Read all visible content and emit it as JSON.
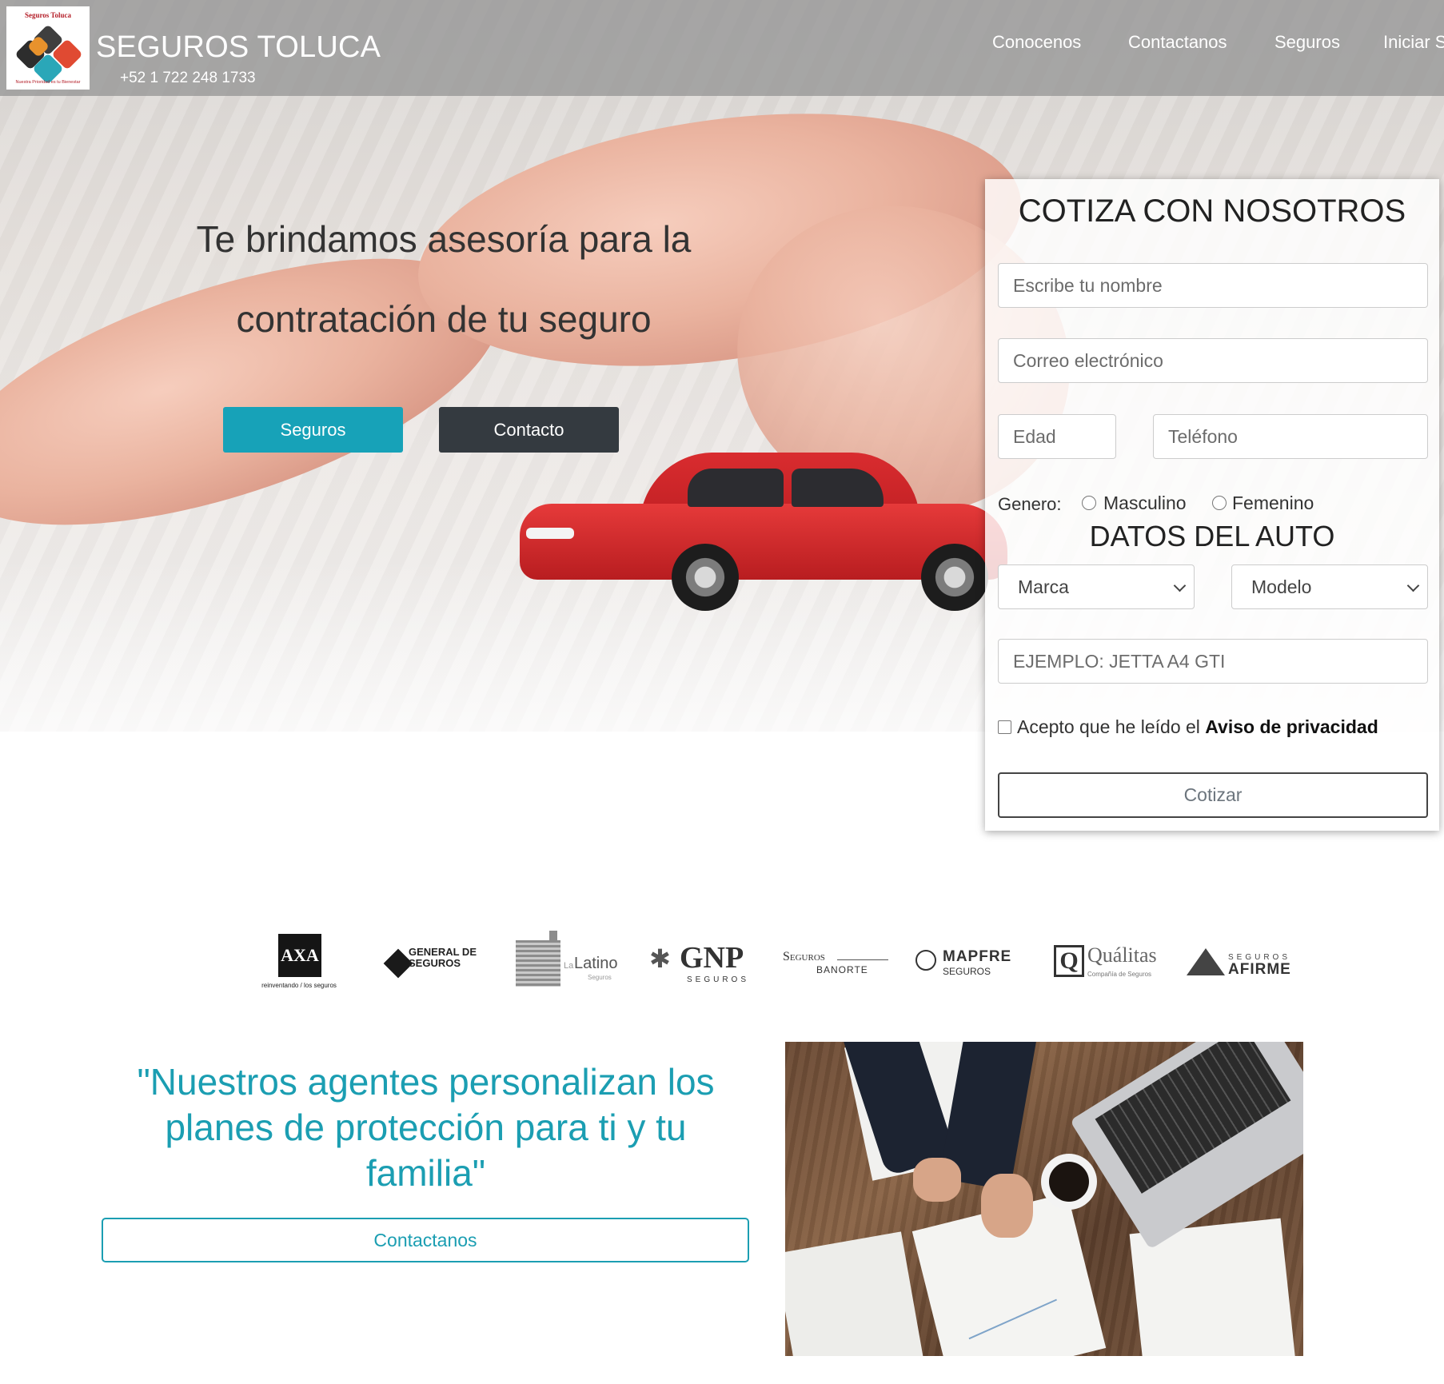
{
  "brand": {
    "title": "SEGUROS TOLUCA",
    "phone": "+52 1 722 248 1733",
    "logo_text_top": "Seguros Toluca",
    "logo_text_bottom": "Nuestra Prioridad es tu Bienestar"
  },
  "nav": {
    "items": [
      "Conocenos",
      "Contactanos",
      "Seguros",
      "Iniciar S"
    ]
  },
  "hero": {
    "line1": "Te brindamos asesoría para la",
    "line2": "contratación de tu seguro",
    "primary_button": "Seguros",
    "secondary_button": "Contacto"
  },
  "form": {
    "title": "COTIZA CON NOSOTROS",
    "name_placeholder": "Escribe tu nombre",
    "email_placeholder": "Correo electrónico",
    "age_placeholder": "Edad",
    "phone_placeholder": "Teléfono",
    "gender_label": "Genero:",
    "gender_options": [
      "Masculino",
      "Femenino"
    ],
    "car_section_title": "DATOS DEL AUTO",
    "brand_select": "Marca",
    "model_select": "Modelo",
    "version_placeholder": "EJEMPLO: JETTA A4 GTI",
    "privacy_text": "Acepto que he leído el",
    "privacy_link": "Aviso de privacidad",
    "submit": "Cotizar"
  },
  "partners": {
    "axa": "AXA",
    "axa_tagline": "reinventando / los seguros",
    "general": "GENERAL DE SEGUROS",
    "latino": "Latino",
    "latino_prefix": "La",
    "latino_sub": "Seguros",
    "gnp": "GNP",
    "gnp_sub": "SEGUROS",
    "banorte_top": "Seguros",
    "banorte_bottom": "BANORTE",
    "mapfre": "MAPFRE",
    "mapfre_sub": "SEGUROS",
    "qualitas": "Quálitas",
    "qualitas_sub": "Compañía de Seguros",
    "afirme_top": "SEGUROS",
    "afirme": "AFIRME"
  },
  "quote": {
    "text": "\"Nuestros agentes personalizan los planes de protección para ti y tu familia\"",
    "button": "Contactanos"
  },
  "colors": {
    "accent": "#1b9eb2",
    "primary_button": "#17a2b8",
    "dark_button": "#343a40"
  }
}
